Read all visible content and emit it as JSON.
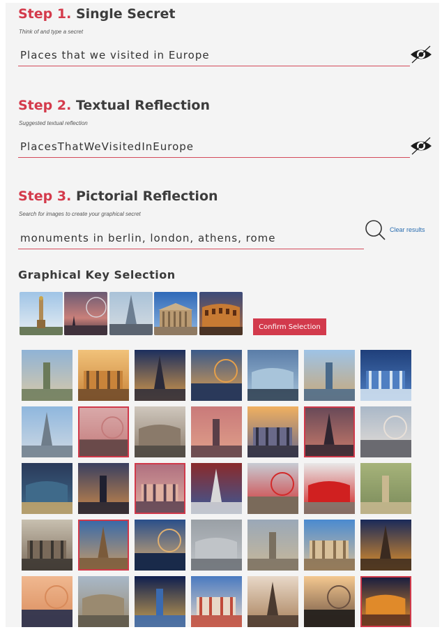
{
  "step1": {
    "number": "Step 1.",
    "title": "Single Secret",
    "hint": "Think of and type a secret",
    "value": "Places that we visited in Europe"
  },
  "step2": {
    "number": "Step 2.",
    "title": "Textual Reflection",
    "hint": "Suggested textual reflection",
    "value": "PlacesThatWeVisitedInEurope"
  },
  "step3": {
    "number": "Step 3.",
    "title": "Pictorial Reflection",
    "hint": "Search for images to create your graphical secret",
    "value": "monuments in berlin, london, athens, rome",
    "clear_label": "Clear results"
  },
  "selection": {
    "title": "Graphical Key Selection",
    "confirm_label": "Confirm Selection",
    "thumbs": [
      {
        "name": "victory-column"
      },
      {
        "name": "london-eye"
      },
      {
        "name": "the-shard"
      },
      {
        "name": "parthenon"
      },
      {
        "name": "colosseum"
      }
    ]
  },
  "grid": {
    "columns": 7,
    "tiles": [
      {
        "name": "berlin-panorama",
        "selected": false
      },
      {
        "name": "brandenburg-gate-day",
        "selected": false
      },
      {
        "name": "brandenburg-gate-night",
        "selected": false
      },
      {
        "name": "berlin-tv-tower-dusk",
        "selected": false
      },
      {
        "name": "reichstag-dome",
        "selected": false
      },
      {
        "name": "berlin-skyline",
        "selected": false
      },
      {
        "name": "visit-berlin-banner",
        "selected": false
      },
      {
        "name": "berlin-cathedral",
        "selected": false
      },
      {
        "name": "victory-column",
        "selected": true
      },
      {
        "name": "berlin-street-crowd",
        "selected": false
      },
      {
        "name": "thames-sunset",
        "selected": false
      },
      {
        "name": "big-ben-westminster",
        "selected": false
      },
      {
        "name": "london-eye",
        "selected": true
      },
      {
        "name": "westminster-aerial",
        "selected": false
      },
      {
        "name": "london-night-river",
        "selected": false
      },
      {
        "name": "parliament-night",
        "selected": false
      },
      {
        "name": "the-shard",
        "selected": true
      },
      {
        "name": "london-underground-collage",
        "selected": false
      },
      {
        "name": "red-bus-big-ben",
        "selected": false
      },
      {
        "name": "red-telephone-box",
        "selected": false
      },
      {
        "name": "athens-hillside",
        "selected": false
      },
      {
        "name": "acropolis-hill",
        "selected": false
      },
      {
        "name": "parthenon",
        "selected": true
      },
      {
        "name": "acropolis-night",
        "selected": false
      },
      {
        "name": "athens-blurred-city",
        "selected": false
      },
      {
        "name": "athens-aerial",
        "selected": false
      },
      {
        "name": "parthenon-columns",
        "selected": false
      },
      {
        "name": "colosseum-night",
        "selected": false
      },
      {
        "name": "st-peters-dome",
        "selected": false
      },
      {
        "name": "st-peters-square",
        "selected": false
      },
      {
        "name": "vatican-night",
        "selected": false
      },
      {
        "name": "positano-coast",
        "selected": false
      },
      {
        "name": "vatican-spiral-stairs",
        "selected": false
      },
      {
        "name": "rome-statue",
        "selected": false
      },
      {
        "name": "colosseum",
        "selected": true
      }
    ]
  },
  "colors": {
    "accent": "#d43a4b",
    "link": "#2a6db0"
  }
}
